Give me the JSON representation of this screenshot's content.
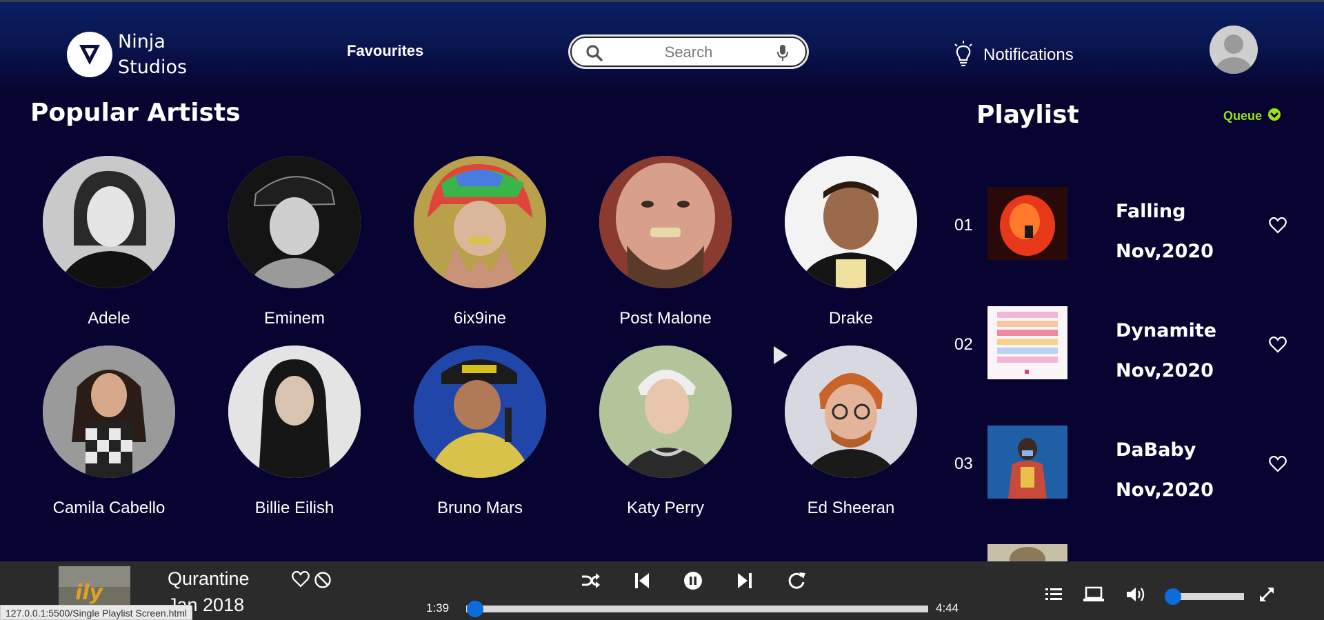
{
  "header": {
    "logo_line1": "Ninja",
    "logo_line2": "Studios",
    "favourites": "Favourites",
    "search_placeholder": "Search",
    "notifications": "Notifications"
  },
  "artists": {
    "title": "Popular Artists",
    "items": [
      {
        "name": "Adele"
      },
      {
        "name": "Eminem"
      },
      {
        "name": "6ix9ine"
      },
      {
        "name": "Post Malone"
      },
      {
        "name": "Drake"
      },
      {
        "name": "Camila Cabello"
      },
      {
        "name": "Billie Eilish"
      },
      {
        "name": "Bruno Mars"
      },
      {
        "name": "Katy Perry"
      },
      {
        "name": "Ed Sheeran"
      }
    ]
  },
  "playlist": {
    "title": "Playlist",
    "queue_label": "Queue",
    "tracks": [
      {
        "num": "01",
        "name": "Falling",
        "date": "Nov,2020"
      },
      {
        "num": "02",
        "name": "Dynamite",
        "date": "Nov,2020"
      },
      {
        "num": "03",
        "name": "DaBaby",
        "date": "Nov,2020"
      }
    ]
  },
  "player": {
    "title": "Qurantine",
    "date": "Jan 2018",
    "current_time": "1:39",
    "total_time": "4:44",
    "progress": 0.02,
    "volume": 0.08
  },
  "status_url": "127.0.0.1:5500/Single Playlist Screen.html",
  "colors": {
    "background": "#070432",
    "header_top": "#0b1f63",
    "accent_green": "#9be11a",
    "player_bar": "#2b2b2b",
    "slider_blue": "#0b6ddb"
  }
}
